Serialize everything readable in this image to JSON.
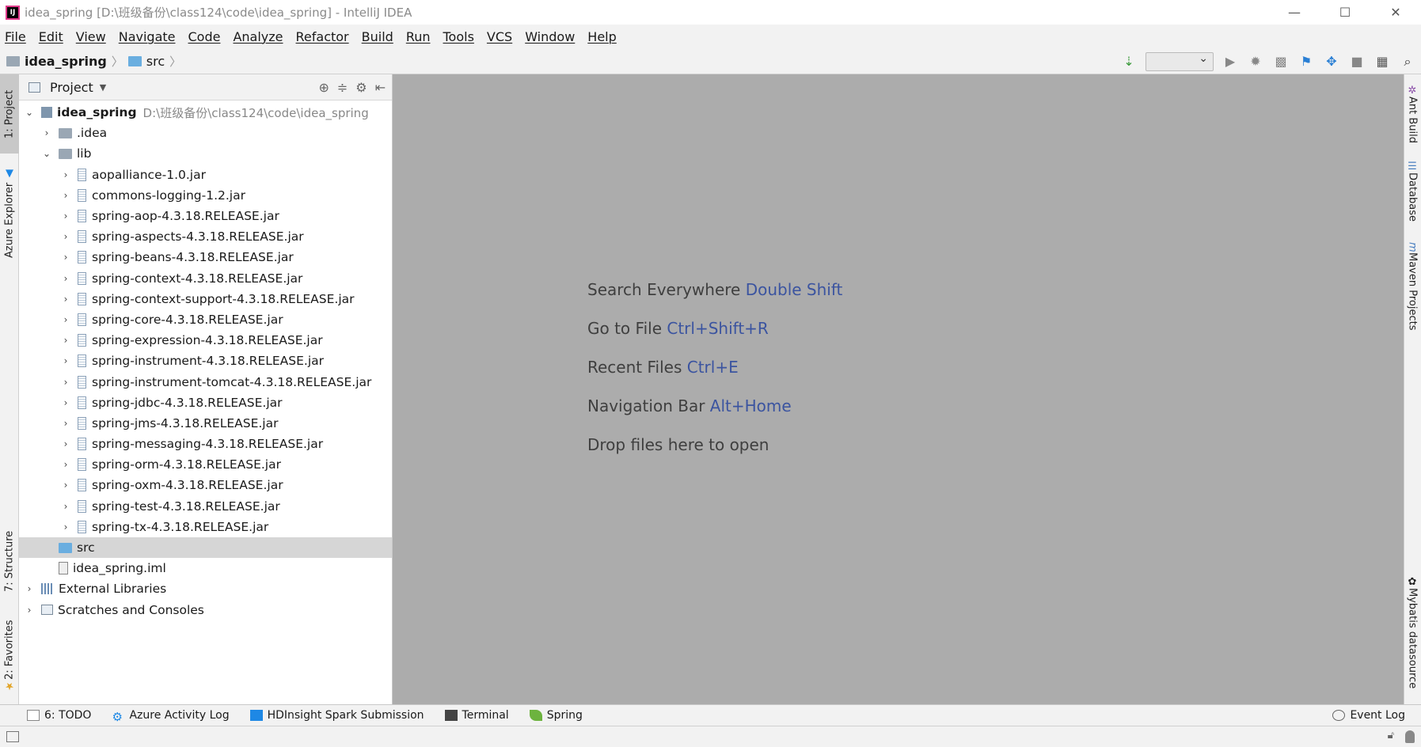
{
  "window": {
    "title": "idea_spring [D:\\班级备份\\class124\\code\\idea_spring] - IntelliJ IDEA",
    "app_icon_text": "IJ",
    "controls": [
      "—",
      "☐",
      "✕"
    ]
  },
  "menu": [
    "File",
    "Edit",
    "View",
    "Navigate",
    "Code",
    "Analyze",
    "Refactor",
    "Build",
    "Run",
    "Tools",
    "VCS",
    "Window",
    "Help"
  ],
  "breadcrumb": {
    "project": "idea_spring",
    "folder": "src"
  },
  "left_tabs": {
    "project": "1: Project",
    "azure": "Azure Explorer",
    "structure": "7: Structure",
    "favorites": "2: Favorites"
  },
  "right_tabs": {
    "ant": "Ant Build",
    "database": "Database",
    "maven": "Maven Projects",
    "mybatis": "Mybatis datasource"
  },
  "project_panel": {
    "title": "Project",
    "root_name": "idea_spring",
    "root_path": "D:\\班级备份\\class124\\code\\idea_spring",
    "idea": ".idea",
    "lib": "lib",
    "jars": [
      "aopalliance-1.0.jar",
      "commons-logging-1.2.jar",
      "spring-aop-4.3.18.RELEASE.jar",
      "spring-aspects-4.3.18.RELEASE.jar",
      "spring-beans-4.3.18.RELEASE.jar",
      "spring-context-4.3.18.RELEASE.jar",
      "spring-context-support-4.3.18.RELEASE.jar",
      "spring-core-4.3.18.RELEASE.jar",
      "spring-expression-4.3.18.RELEASE.jar",
      "spring-instrument-4.3.18.RELEASE.jar",
      "spring-instrument-tomcat-4.3.18.RELEASE.jar",
      "spring-jdbc-4.3.18.RELEASE.jar",
      "spring-jms-4.3.18.RELEASE.jar",
      "spring-messaging-4.3.18.RELEASE.jar",
      "spring-orm-4.3.18.RELEASE.jar",
      "spring-oxm-4.3.18.RELEASE.jar",
      "spring-test-4.3.18.RELEASE.jar",
      "spring-tx-4.3.18.RELEASE.jar"
    ],
    "src": "src",
    "iml": "idea_spring.iml",
    "external_libraries": "External Libraries",
    "scratches": "Scratches and Consoles"
  },
  "editor_hints": [
    {
      "label": "Search Everywhere",
      "key": "Double Shift"
    },
    {
      "label": "Go to File",
      "key": "Ctrl+Shift+R"
    },
    {
      "label": "Recent Files",
      "key": "Ctrl+E"
    },
    {
      "label": "Navigation Bar",
      "key": "Alt+Home"
    },
    {
      "label": "Drop files here to open",
      "key": ""
    }
  ],
  "bottom_tabs": {
    "todo": "6: TODO",
    "azure_log": "Azure Activity Log",
    "hdinsight": "HDInsight Spark Submission",
    "terminal": "Terminal",
    "spring": "Spring",
    "event_log": "Event Log"
  },
  "colors": {
    "editor_bg": "#acacac",
    "hint_key": "#3b54a0",
    "selected_row": "#d6d6d6"
  }
}
